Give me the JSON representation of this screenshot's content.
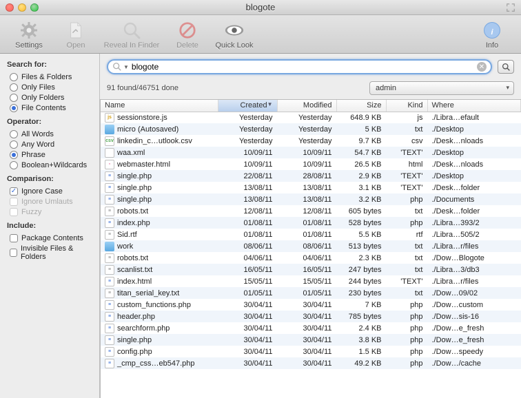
{
  "window": {
    "title": "blogote"
  },
  "toolbar": {
    "settings": "Settings",
    "open": "Open",
    "reveal": "Reveal In Finder",
    "delete": "Delete",
    "quicklook": "Quick Look",
    "info": "Info"
  },
  "sidebar": {
    "search_for_heading": "Search for:",
    "search_for": [
      {
        "label": "Files & Folders",
        "selected": false
      },
      {
        "label": "Only Files",
        "selected": false
      },
      {
        "label": "Only Folders",
        "selected": false
      },
      {
        "label": "File Contents",
        "selected": true
      }
    ],
    "operator_heading": "Operator:",
    "operator": [
      {
        "label": "All Words",
        "selected": false
      },
      {
        "label": "Any Word",
        "selected": false
      },
      {
        "label": "Phrase",
        "selected": true
      },
      {
        "label": "Boolean+Wildcards",
        "selected": false
      }
    ],
    "comparison_heading": "Comparison:",
    "comparison": [
      {
        "label": "Ignore Case",
        "checked": true,
        "enabled": true
      },
      {
        "label": "Ignore Umlauts",
        "checked": false,
        "enabled": false
      },
      {
        "label": "Fuzzy",
        "checked": false,
        "enabled": false
      }
    ],
    "include_heading": "Include:",
    "include": [
      {
        "label": "Package Contents",
        "checked": false
      },
      {
        "label": "Invisible Files & Folders",
        "checked": false
      }
    ]
  },
  "search": {
    "value": "blogote"
  },
  "status": {
    "text": "91 found/46751 done",
    "scope": "admin"
  },
  "columns": {
    "name": "Name",
    "created": "Created",
    "modified": "Modified",
    "size": "Size",
    "kind": "Kind",
    "where": "Where"
  },
  "rows": [
    {
      "icon": "js",
      "name": "sessionstore.js",
      "created": "Yesterday",
      "modified": "Yesterday",
      "size": "648.9 KB",
      "kind": "js",
      "where": "./Libra…efault"
    },
    {
      "icon": "folder",
      "name": "micro (Autosaved)",
      "created": "Yesterday",
      "modified": "Yesterday",
      "size": "5 KB",
      "kind": "txt",
      "where": "./Desktop"
    },
    {
      "icon": "csv",
      "name": "linkedin_c…utlook.csv",
      "created": "Yesterday",
      "modified": "Yesterday",
      "size": "9.7 KB",
      "kind": "csv",
      "where": "./Desk…nloads"
    },
    {
      "icon": "doc",
      "name": "waa.xml",
      "created": "10/09/11",
      "modified": "10/09/11",
      "size": "54.7 KB",
      "kind": "'TEXT'",
      "where": "./Desktop"
    },
    {
      "icon": "html",
      "name": "webmaster.html",
      "created": "10/09/11",
      "modified": "10/09/11",
      "size": "26.5 KB",
      "kind": "html",
      "where": "./Desk…nloads"
    },
    {
      "icon": "php",
      "name": "single.php",
      "created": "22/08/11",
      "modified": "28/08/11",
      "size": "2.9 KB",
      "kind": "'TEXT'",
      "where": "./Desktop"
    },
    {
      "icon": "php",
      "name": "single.php",
      "created": "13/08/11",
      "modified": "13/08/11",
      "size": "3.1 KB",
      "kind": "'TEXT'",
      "where": "./Desk…folder"
    },
    {
      "icon": "php",
      "name": "single.php",
      "created": "13/08/11",
      "modified": "13/08/11",
      "size": "3.2 KB",
      "kind": "php",
      "where": "./Documents"
    },
    {
      "icon": "txt",
      "name": "robots.txt",
      "created": "12/08/11",
      "modified": "12/08/11",
      "size": "605 bytes",
      "kind": "txt",
      "where": "./Desk…folder"
    },
    {
      "icon": "php",
      "name": "index.php",
      "created": "01/08/11",
      "modified": "01/08/11",
      "size": "528 bytes",
      "kind": "php",
      "where": "./Libra…393/2"
    },
    {
      "icon": "rtf",
      "name": "Sid.rtf",
      "created": "01/08/11",
      "modified": "01/08/11",
      "size": "5.5 KB",
      "kind": "rtf",
      "where": "./Libra…505/2"
    },
    {
      "icon": "folder",
      "name": "work",
      "created": "08/06/11",
      "modified": "08/06/11",
      "size": "513 bytes",
      "kind": "txt",
      "where": "./Libra…r/files"
    },
    {
      "icon": "txt",
      "name": "robots.txt",
      "created": "04/06/11",
      "modified": "04/06/11",
      "size": "2.3 KB",
      "kind": "txt",
      "where": "./Dow…Blogote"
    },
    {
      "icon": "txt",
      "name": "scanlist.txt",
      "created": "16/05/11",
      "modified": "16/05/11",
      "size": "247 bytes",
      "kind": "txt",
      "where": "./Libra…3/db3"
    },
    {
      "icon": "php",
      "name": "index.html",
      "created": "15/05/11",
      "modified": "15/05/11",
      "size": "244 bytes",
      "kind": "'TEXT'",
      "where": "./Libra…r/files"
    },
    {
      "icon": "txt",
      "name": "titan_serial_key.txt",
      "created": "01/05/11",
      "modified": "01/05/11",
      "size": "230 bytes",
      "kind": "txt",
      "where": "./Dow…09/02"
    },
    {
      "icon": "php",
      "name": "custom_functions.php",
      "created": "30/04/11",
      "modified": "30/04/11",
      "size": "7 KB",
      "kind": "php",
      "where": "./Dow…custom"
    },
    {
      "icon": "php",
      "name": "header.php",
      "created": "30/04/11",
      "modified": "30/04/11",
      "size": "785 bytes",
      "kind": "php",
      "where": "./Dow…sis-16"
    },
    {
      "icon": "php",
      "name": "searchform.php",
      "created": "30/04/11",
      "modified": "30/04/11",
      "size": "2.4 KB",
      "kind": "php",
      "where": "./Dow…e_fresh"
    },
    {
      "icon": "php",
      "name": "single.php",
      "created": "30/04/11",
      "modified": "30/04/11",
      "size": "3.8 KB",
      "kind": "php",
      "where": "./Dow…e_fresh"
    },
    {
      "icon": "php",
      "name": "config.php",
      "created": "30/04/11",
      "modified": "30/04/11",
      "size": "1.5 KB",
      "kind": "php",
      "where": "./Dow…speedy"
    },
    {
      "icon": "php",
      "name": "_cmp_css…eb547.php",
      "created": "30/04/11",
      "modified": "30/04/11",
      "size": "49.2 KB",
      "kind": "php",
      "where": "./Dow…/cache"
    }
  ]
}
